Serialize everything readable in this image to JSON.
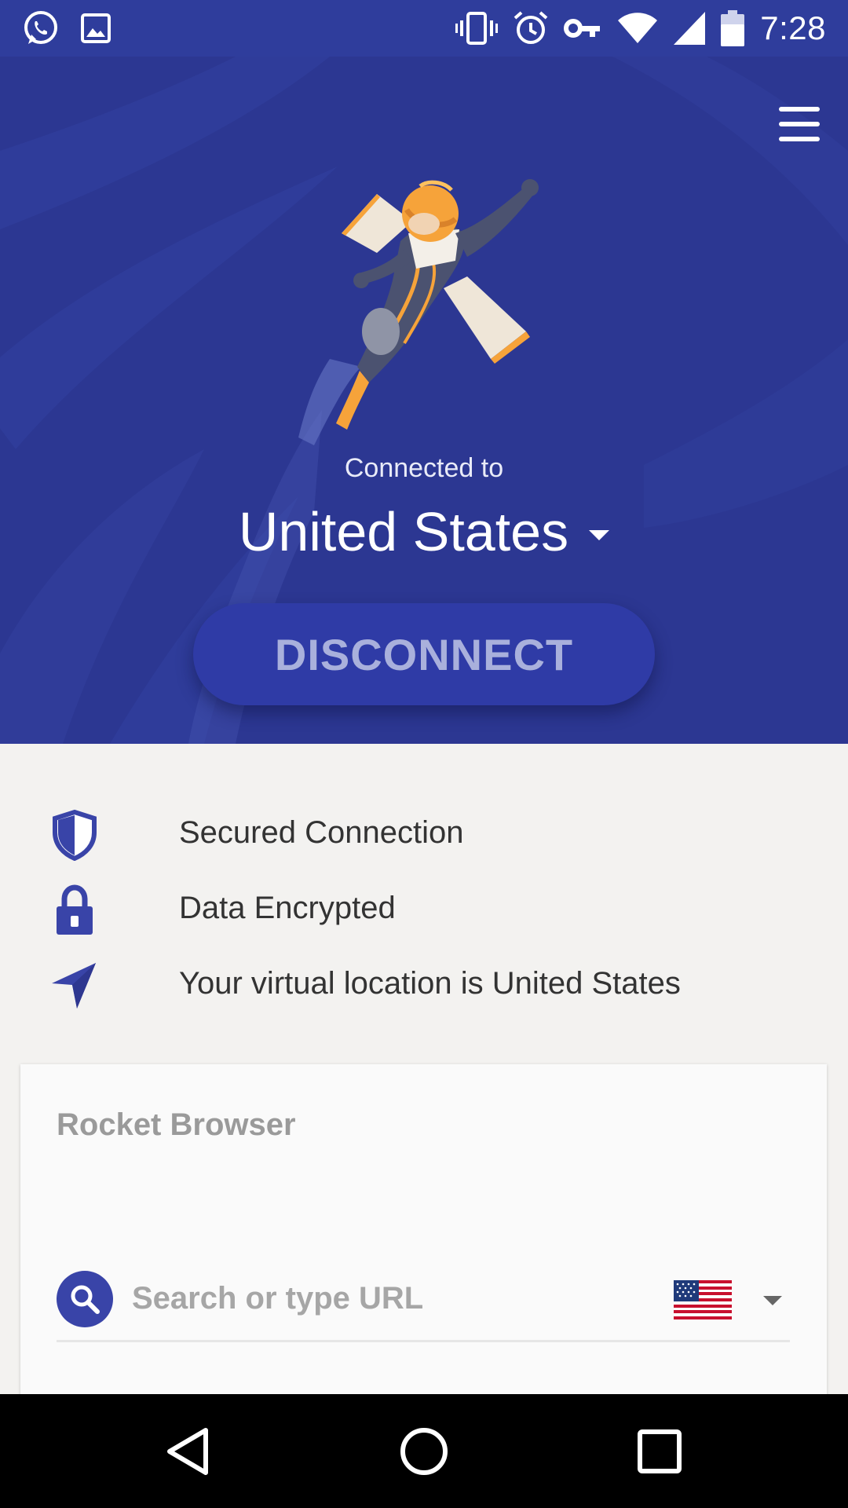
{
  "status_bar": {
    "time": "7:28",
    "left_icons": [
      "whatsapp-icon",
      "image-icon"
    ],
    "right_icons": [
      "vibrate-icon",
      "alarm-icon",
      "vpn-key-icon",
      "wifi-icon",
      "cell-signal-icon",
      "battery-icon"
    ]
  },
  "hero": {
    "connected_label": "Connected to",
    "country": "United States",
    "disconnect_label": "DISCONNECT",
    "background_color": "#2c3792"
  },
  "status_items": [
    {
      "icon": "shield-icon",
      "label": "Secured Connection"
    },
    {
      "icon": "lock-icon",
      "label": "Data Encrypted"
    },
    {
      "icon": "location-arrow-icon",
      "label": "Your virtual location is United States"
    }
  ],
  "browser": {
    "title": "Rocket Browser",
    "search_placeholder": "Search or type URL",
    "search_value": "",
    "selected_region_icon": "us-flag-icon"
  },
  "nav": {
    "buttons": [
      "back-icon",
      "home-icon",
      "recents-icon"
    ]
  },
  "colors": {
    "accent": "#3944a8",
    "status_bar": "#2f3d9c",
    "page_background": "#f3f2f0"
  }
}
